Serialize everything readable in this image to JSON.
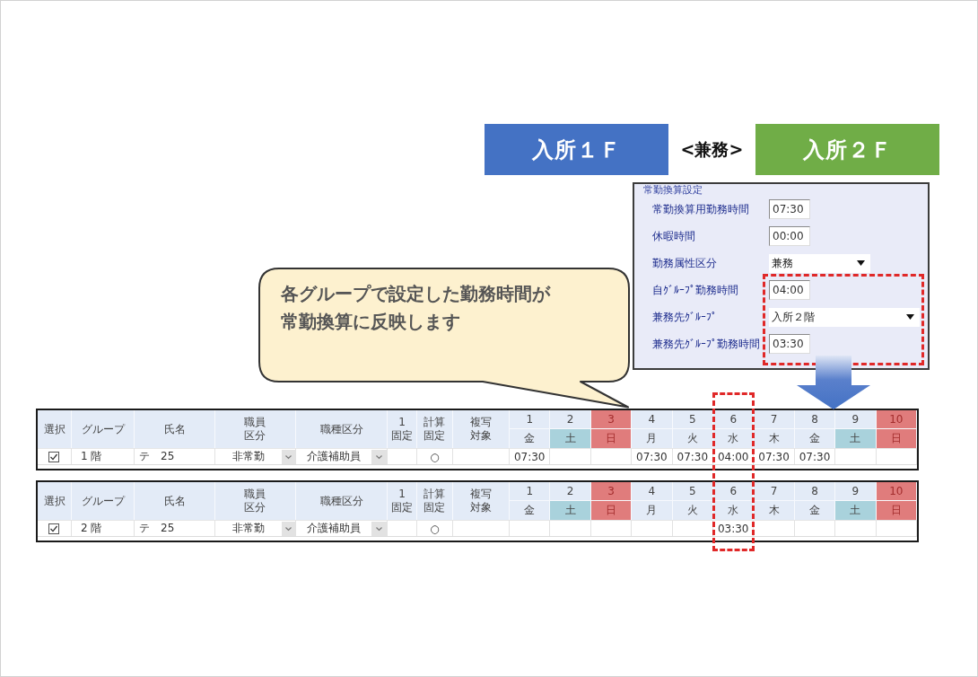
{
  "banners": [
    {
      "label": "入所１Ｆ",
      "color": "#4472c4"
    },
    {
      "label": "入所２Ｆ",
      "color": "#70ad47"
    }
  ],
  "connector": "<兼務>",
  "callout": {
    "lines": [
      "各グループで設定した勤務時間が",
      "常勤換算に反映します"
    ]
  },
  "settings_panel": {
    "title": "常勤換算設定",
    "rows": [
      {
        "kind": "input",
        "label": "常勤換算用勤務時間",
        "value": "07:30",
        "highlighted": false
      },
      {
        "kind": "input",
        "label": "休暇時間",
        "value": "00:00",
        "highlighted": false
      },
      {
        "kind": "select",
        "label": "勤務属性区分",
        "value": "兼務",
        "wide": false,
        "highlighted": false
      },
      {
        "kind": "input",
        "label": "自ｸﾞﾙｰﾌﾟ勤務時間",
        "value": "04:00",
        "highlighted": true
      },
      {
        "kind": "select",
        "label": "兼務先ｸﾞﾙｰﾌﾟ",
        "value": "入所２階",
        "wide": true,
        "highlighted": true
      },
      {
        "kind": "input",
        "label": "兼務先ｸﾞﾙｰﾌﾟ勤務時間",
        "value": "03:30",
        "highlighted": true
      }
    ]
  },
  "tables": [
    {
      "columns": [
        {
          "label": "選択",
          "stacked": false
        },
        {
          "label": "グループ",
          "stacked": false
        },
        {
          "label": "氏名",
          "stacked": false
        },
        {
          "label": "職員区分",
          "stacked": true
        },
        {
          "label": "職種区分",
          "stacked": false
        },
        {
          "label": "1\n固定",
          "stacked": true
        },
        {
          "label": "計算固定",
          "stacked": true
        },
        {
          "label": "複写対象",
          "stacked": true
        }
      ],
      "days": [
        {
          "date": "1",
          "weekday": "金",
          "kind": "weekday",
          "highlighted": false,
          "value": "07:30"
        },
        {
          "date": "2",
          "weekday": "土",
          "kind": "saturday",
          "highlighted": false
        },
        {
          "date": "3",
          "weekday": "日",
          "kind": "sunday",
          "highlighted": false
        },
        {
          "date": "4",
          "weekday": "月",
          "kind": "weekday",
          "highlighted": false,
          "value": "07:30"
        },
        {
          "date": "5",
          "weekday": "火",
          "kind": "weekday",
          "highlighted": false,
          "value": "07:30"
        },
        {
          "date": "6",
          "weekday": "水",
          "kind": "weekday",
          "highlighted": true,
          "value": "04:00"
        },
        {
          "date": "7",
          "weekday": "木",
          "kind": "weekday",
          "highlighted": false,
          "value": "07:30"
        },
        {
          "date": "8",
          "weekday": "金",
          "kind": "weekday",
          "highlighted": false,
          "value": "07:30"
        },
        {
          "date": "9",
          "weekday": "土",
          "kind": "saturday",
          "highlighted": false
        },
        {
          "date": "10",
          "weekday": "日",
          "kind": "sunday",
          "highlighted": false
        }
      ],
      "row": {
        "checked": true,
        "group": "1 階",
        "name": "テ　25",
        "employment_type": "非常勤",
        "job_type": "介護補助員",
        "calc_fixed": "○"
      }
    },
    {
      "columns": [
        {
          "label": "選択",
          "stacked": false
        },
        {
          "label": "グループ",
          "stacked": false
        },
        {
          "label": "氏名",
          "stacked": false
        },
        {
          "label": "職員区分",
          "stacked": true
        },
        {
          "label": "職種区分",
          "stacked": false
        },
        {
          "label": "1\n固定",
          "stacked": true
        },
        {
          "label": "計算固定",
          "stacked": true
        },
        {
          "label": "複写対象",
          "stacked": true
        }
      ],
      "days": [
        {
          "date": "1",
          "weekday": "金",
          "kind": "weekday",
          "highlighted": false
        },
        {
          "date": "2",
          "weekday": "土",
          "kind": "saturday",
          "highlighted": false
        },
        {
          "date": "3",
          "weekday": "日",
          "kind": "sunday",
          "highlighted": false
        },
        {
          "date": "4",
          "weekday": "月",
          "kind": "weekday",
          "highlighted": false
        },
        {
          "date": "5",
          "weekday": "火",
          "kind": "weekday",
          "highlighted": false
        },
        {
          "date": "6",
          "weekday": "水",
          "kind": "weekday",
          "highlighted": true,
          "value": "03:30"
        },
        {
          "date": "7",
          "weekday": "木",
          "kind": "weekday",
          "highlighted": false
        },
        {
          "date": "8",
          "weekday": "金",
          "kind": "weekday",
          "highlighted": false
        },
        {
          "date": "9",
          "weekday": "土",
          "kind": "saturday",
          "highlighted": false
        },
        {
          "date": "10",
          "weekday": "日",
          "kind": "sunday",
          "highlighted": false
        }
      ],
      "row": {
        "checked": true,
        "group": "2 階",
        "name": "テ　25",
        "employment_type": "非常勤",
        "job_type": "介護補助員",
        "calc_fixed": "○"
      }
    }
  ]
}
